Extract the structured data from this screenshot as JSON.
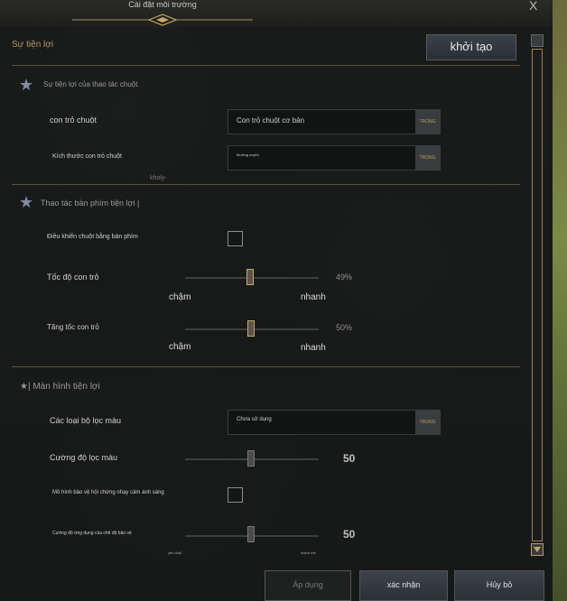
{
  "window": {
    "title": "Cài đặt môi trường",
    "close_glyph": "X"
  },
  "header": {
    "section": "Sự tiện lợi",
    "reset_button": "khởi tạo"
  },
  "mouse": {
    "heading": "Sự tiện lợi của thao tác chuột",
    "cursor_label": "con trỏ chuột",
    "cursor_value": "Con trỏ chuột cơ bản",
    "cursor_btn": "TRONG",
    "size_label": "Kích thước con trỏ chuột",
    "size_value": "thường xuyên",
    "size_btn": "TRONG",
    "stray": "kholy-"
  },
  "keyboard": {
    "heading": "Thao tác bàn phím tiện lợi |",
    "kb_mouse_label": "Điều khiển chuột bằng bàn phím",
    "speed_label": "Tốc độ con trỏ",
    "speed_value": "49%",
    "speed_level": 0.49,
    "speed_min": "chậm",
    "speed_max": "nhanh",
    "accel_label": "Tăng tốc con trỏ",
    "accel_value": "50%",
    "accel_level": 0.5,
    "accel_min": "chậm",
    "accel_max": "nhanh"
  },
  "screen": {
    "heading": "★| Màn hình tiện lợi",
    "filter_type_label": "Các loại bộ lọc màu",
    "filter_type_value": "Chưa sử dụng",
    "filter_type_btn": "TRONG",
    "filter_strength_label": "Cường độ lọc màu",
    "filter_strength_value": "50",
    "photo_label": "Mô hình bảo vệ hội chứng nhạy cảm ánh sáng",
    "protect_label": "Cường độ ứng dụng của chế độ bảo vệ",
    "protect_value": "50",
    "protect_min": "yếu đuối",
    "protect_max": "mạnh mẽ"
  },
  "footer": {
    "apply": "Áp dụng",
    "confirm": "xác nhận",
    "cancel": "Hủy bỏ"
  },
  "colors": {
    "accent_gold": "#b89a63",
    "panel": "#141616"
  }
}
